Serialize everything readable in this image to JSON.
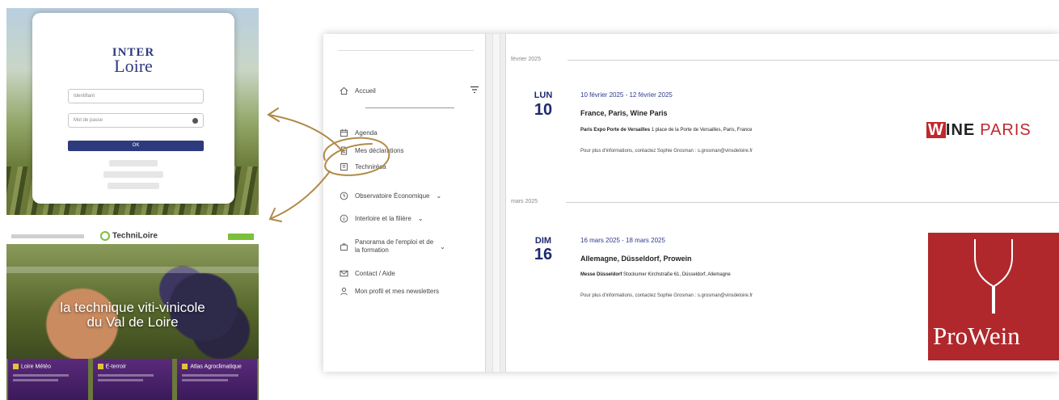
{
  "login_screen": {
    "logo_line1": "INTER",
    "logo_line2": "Loire",
    "username_placeholder": "Identifiant",
    "password_placeholder": "Mot de passe",
    "submit_label": "OK"
  },
  "techni_screen": {
    "logo": "TechniLoire",
    "hero_line1": "la technique viti-vinicole",
    "hero_line2": "du Val de Loire",
    "cards": [
      {
        "label": "Loire Météo"
      },
      {
        "label": "E-terroir"
      },
      {
        "label": "Atlas Agroclimatique"
      }
    ]
  },
  "sidebar": {
    "accueil": "Accueil",
    "agenda": "Agenda",
    "declarations": "Mes déclarations",
    "technireso": "Technirésa",
    "observatoire": "Observatoire Économique",
    "interloire": "Interloire et la filière",
    "panorama_line1": "Panorama de l'emploi et de",
    "panorama_line2": "la formation",
    "contact": "Contact / Aide",
    "profil": "Mon profil et mes newsletters",
    "chevron": "⌄"
  },
  "agenda": {
    "months": [
      {
        "label": "février 2025"
      },
      {
        "label": "mars 2025"
      }
    ],
    "events": [
      {
        "day_name": "LUN",
        "day_num": "10",
        "date_range": "10 février 2025 - 12 février 2025",
        "title": "France, Paris, Wine Paris",
        "venue": "Paris Expo Porte de Versailles",
        "address": "1 place de la Porte de Versailles, Paris, France",
        "info": "Pour plus d'informations, contactez Sophie Grosman : s.grosman@vinsdeloire.fr",
        "logo_w": "W",
        "logo_ine": "INE",
        "logo_paris": "PARIS"
      },
      {
        "day_name": "DIM",
        "day_num": "16",
        "date_range": "16 mars 2025 - 18 mars 2025",
        "title": "Allemagne, Düsseldorf, Prowein",
        "venue": "Messe Düsseldorf",
        "address": "Stockumer Kirchstraße 61, Düsseldorf, Allemagne",
        "info": "Pour plus d'informations, contactez Sophie Grosman : s.grosman@vinsdeloire.fr",
        "logo_text": "ProWein"
      }
    ]
  },
  "colors": {
    "brand_navy": "#1e2a6e",
    "annotation_gold": "#b08a48",
    "wine_red": "#c0282d",
    "prowein_red": "#b0282c"
  }
}
